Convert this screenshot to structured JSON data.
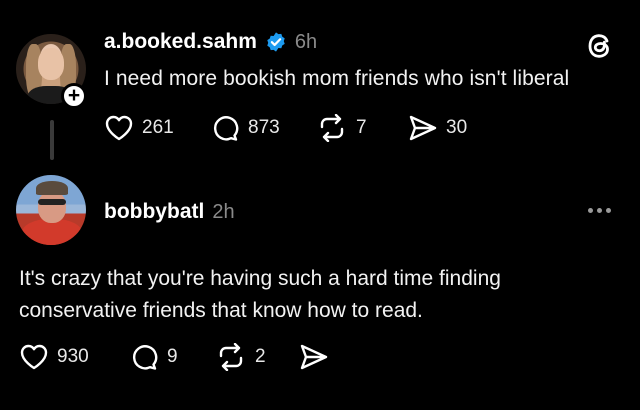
{
  "post": {
    "username": "a.booked.sahm",
    "time": "6h",
    "text": "I need more bookish mom friends who isn't liberal",
    "likes": "261",
    "replies": "873",
    "reposts": "7",
    "shares": "30"
  },
  "reply": {
    "username": "bobbybatl",
    "time": "2h",
    "text_line1": "It's crazy that you're having such a hard time finding",
    "text_line2": "conservative friends that know how to read.",
    "likes": "930",
    "replies": "9",
    "reposts": "2"
  },
  "icons": {
    "app_logo": "threads-logo-icon",
    "verified": "verified-badge-icon",
    "like": "heart-icon",
    "reply": "comment-bubble-icon",
    "repost": "repost-arrows-icon",
    "share": "send-icon",
    "follow": "plus-icon",
    "more": "more-dots-icon"
  },
  "colors": {
    "background": "#000000",
    "verified_blue": "#1d9bf0",
    "muted_text": "#8a8a8a"
  }
}
